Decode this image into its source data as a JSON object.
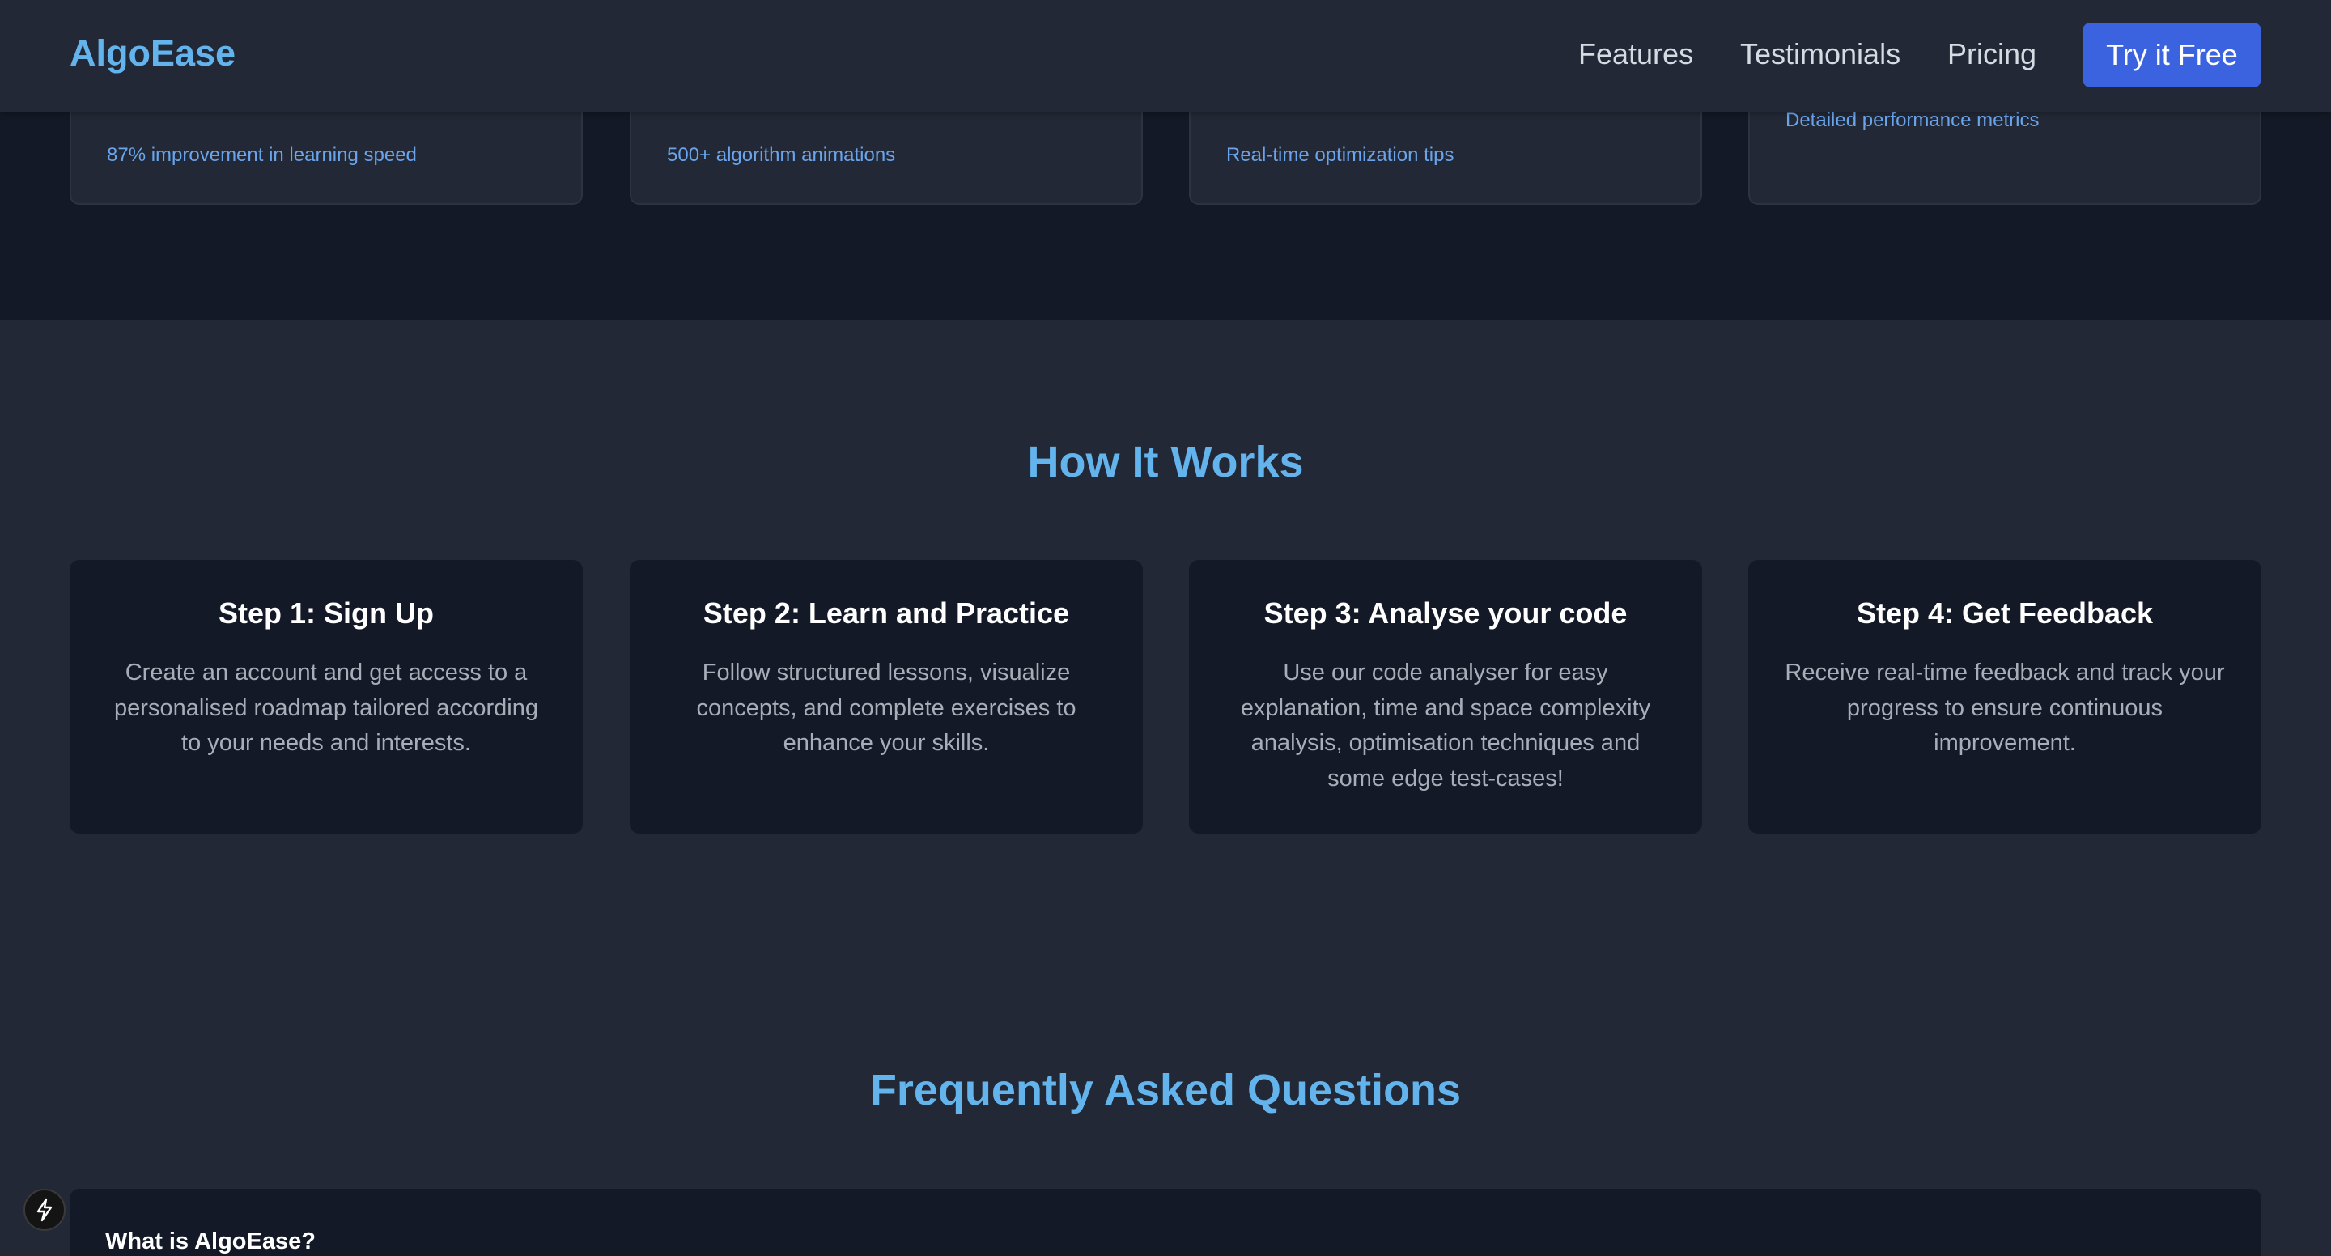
{
  "navbar": {
    "brand": "AlgoEase",
    "links": [
      "Features",
      "Testimonials",
      "Pricing"
    ],
    "cta_label": "Try it Free"
  },
  "features": {
    "stats": [
      "87% improvement in learning speed",
      "500+ algorithm animations",
      "Real-time optimization tips",
      "Detailed performance metrics"
    ]
  },
  "how_it_works": {
    "title": "How It Works",
    "steps": [
      {
        "title": "Step 1: Sign Up",
        "description": "Create an account and get access to a personalised roadmap tailored according to your needs and interests."
      },
      {
        "title": "Step 2: Learn and Practice",
        "description": "Follow structured lessons, visualize concepts, and complete exercises to enhance your skills."
      },
      {
        "title": "Step 3: Analyse your code",
        "description": "Use our code analyser for easy explanation, time and space complexity analysis, optimisation techniques and some edge test-cases!"
      },
      {
        "title": "Step 4: Get Feedback",
        "description": "Receive real-time feedback and track your progress to ensure continuous improvement."
      }
    ]
  },
  "faq": {
    "title": "Frequently Asked Questions",
    "items": [
      {
        "question": "What is AlgoEase?"
      }
    ]
  },
  "icons": {
    "floating_button": "lightning-bolt-icon"
  },
  "colors": {
    "accent": "#63b3ed",
    "cta": "#3b63e0",
    "background": "#222836",
    "card": "#131926"
  }
}
